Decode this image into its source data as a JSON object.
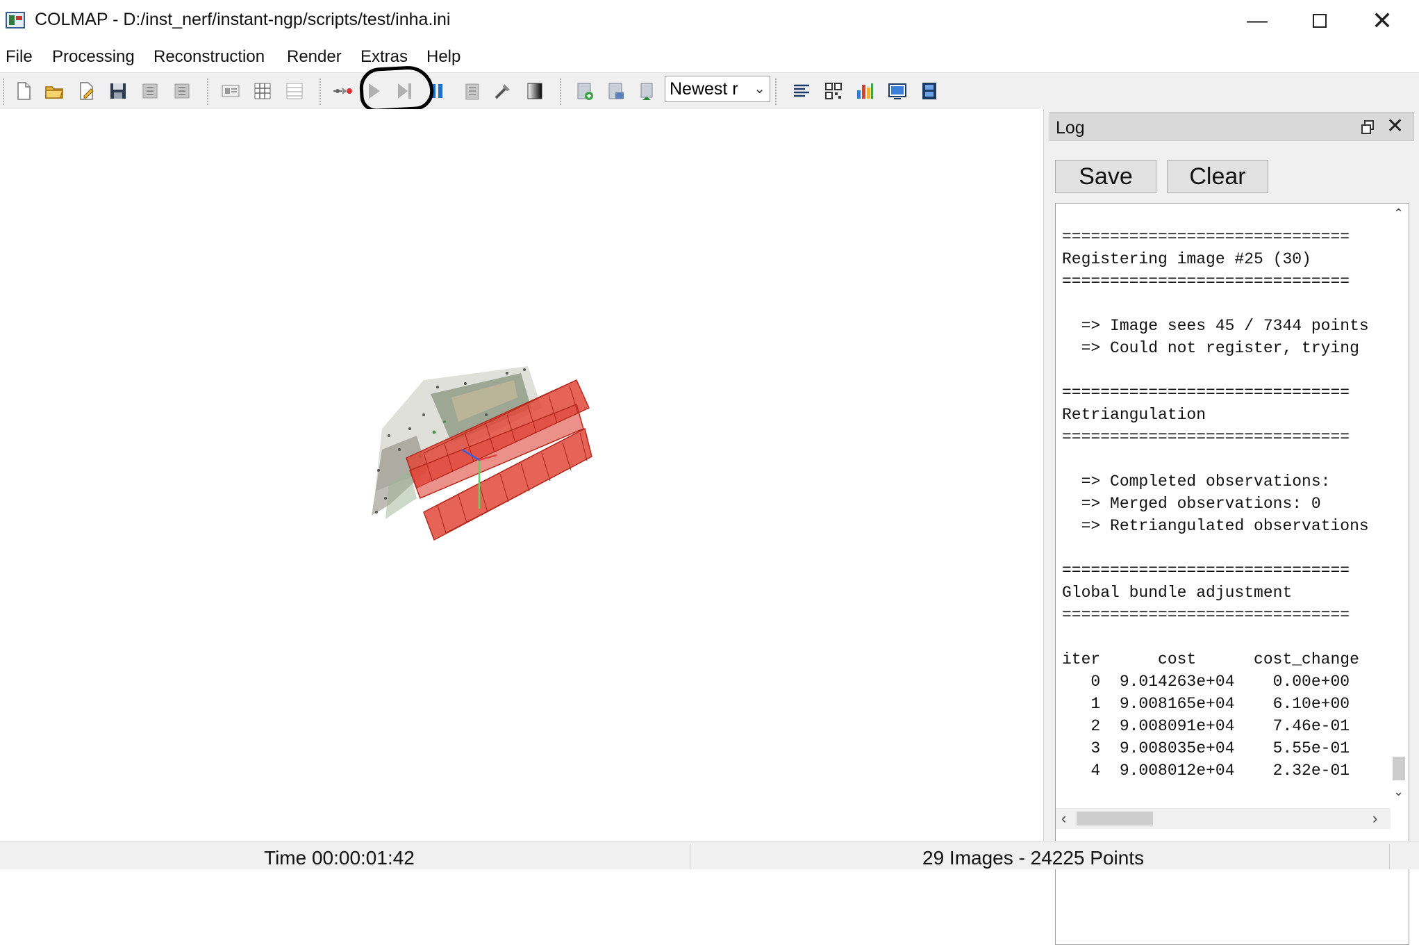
{
  "window": {
    "title": "COLMAP - D:/inst_nerf/instant-ngp/scripts/test/inha.ini",
    "minimize_glyph": "—",
    "close_glyph": "✕"
  },
  "menu": [
    "File",
    "Processing",
    "Reconstruction",
    "Render",
    "Extras",
    "Help"
  ],
  "toolbar": {
    "reconstruction_select": "Newest r",
    "icons": [
      "new-project-icon",
      "open-project-icon",
      "edit-project-icon",
      "save-project-icon",
      "import-icon",
      "export-icon",
      "feature-extraction-icon",
      "feature-matching-icon",
      "database-management-icon",
      "automatic-reconstruction-icon",
      "start-reconstruction-icon",
      "step-reconstruction-icon",
      "pause-reconstruction-icon",
      "reconstruction-options-icon",
      "bundle-adjustment-icon",
      "dense-reconstruction-icon",
      "render-grab-image-icon",
      "render-grab-movie-icon",
      "render-reset-icon",
      "log-icon",
      "match-matrix-icon",
      "reconstruction-stats-icon",
      "render-options-icon",
      "grab-movie-icon"
    ]
  },
  "log": {
    "title": "Log",
    "save_label": "Save",
    "clear_label": "Clear",
    "lines": [
      "==============================",
      "Registering image #25 (30)",
      "==============================",
      "",
      "  => Image sees 45 / 7344 points",
      "  => Could not register, trying",
      "",
      "==============================",
      "Retriangulation",
      "==============================",
      "",
      "  => Completed observations: ",
      "  => Merged observations: 0",
      "  => Retriangulated observations",
      "",
      "==============================",
      "Global bundle adjustment",
      "==============================",
      "",
      "iter      cost      cost_change",
      "   0  9.014263e+04    0.00e+00",
      "   1  9.008165e+04    6.10e+00",
      "   2  9.008091e+04    7.46e-01",
      "   3  9.008035e+04    5.55e-01",
      "   4  9.008012e+04    2.32e-01"
    ]
  },
  "status": {
    "time": "Time 00:00:01:42",
    "summary": "29 Images - 24225 Points"
  }
}
